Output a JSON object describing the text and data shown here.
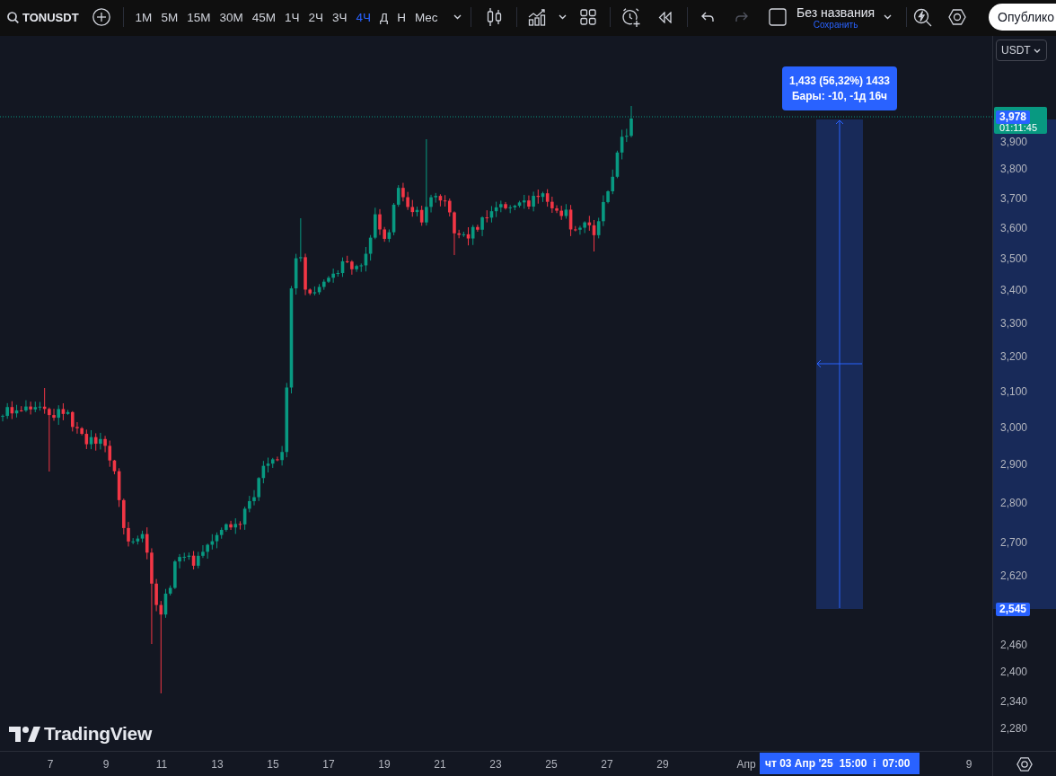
{
  "toolbar": {
    "symbol": "TONUSDT",
    "intervals": [
      {
        "label": "1M",
        "selected": false
      },
      {
        "label": "5M",
        "selected": false
      },
      {
        "label": "15M",
        "selected": false
      },
      {
        "label": "30M",
        "selected": false
      },
      {
        "label": "45M",
        "selected": false
      },
      {
        "label": "1Ч",
        "selected": false
      },
      {
        "label": "2Ч",
        "selected": false
      },
      {
        "label": "3Ч",
        "selected": false
      },
      {
        "label": "4Ч",
        "selected": true
      },
      {
        "label": "Д",
        "selected": false
      },
      {
        "label": "Н",
        "selected": false
      },
      {
        "label": "Мес",
        "selected": false
      }
    ],
    "history": [
      {
        "kind": "undo",
        "disabled": false
      },
      {
        "kind": "redo",
        "disabled": true
      }
    ],
    "layout_name": "Без названия",
    "save_label": "Сохранить",
    "publish_button": "Опублико"
  },
  "chart": {
    "logo": "TradingView",
    "measure": {
      "change": "1,433 (56,32%) 1433",
      "bars": "Бары: -10, -1д 16ч"
    },
    "price_axis": {
      "currency": "USDT",
      "ticks": [
        "3,900",
        "3,800",
        "3,700",
        "3,600",
        "3,500",
        "3,400",
        "3,300",
        "3,200",
        "3,100",
        "3,000",
        "2,900",
        "2,800",
        "2,700",
        "2,620",
        "2,460",
        "2,400",
        "2,340",
        "2,280"
      ],
      "countdown": "01:11:45",
      "range_labels": [
        "3,978",
        "2,545"
      ]
    },
    "time_axis": {
      "ticks": [
        "7",
        "9",
        "11",
        "13",
        "15",
        "17",
        "19",
        "21",
        "23",
        "25",
        "27",
        "29",
        "Апр",
        "9"
      ],
      "range_label": [
        "чт 03 Апр '25",
        "15:00",
        "i",
        "07:00"
      ]
    }
  }
}
